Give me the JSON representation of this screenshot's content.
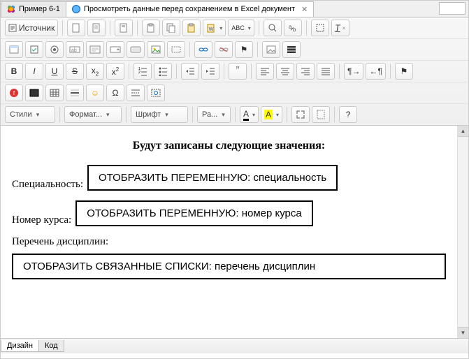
{
  "topTabs": {
    "tab1": "Пример 6-1",
    "tab2": "Просмотреть данные перед сохранением в Excel документ"
  },
  "toolbar": {
    "source": "Источник",
    "styles": "Стили",
    "format": "Формат...",
    "font": "Шрифт",
    "size": "Ра...",
    "textColor": "A",
    "bgColor": "A",
    "bold": "B",
    "italic": "I",
    "underline": "U",
    "strike": "S",
    "omega": "Ω",
    "smile": "☺",
    "question": "?",
    "abc": "ABC",
    "flag": "⚑"
  },
  "doc": {
    "heading": "Будут записаны следующие значения:",
    "label1": "Специальность:",
    "box1": "ОТОБРАЗИТЬ ПЕРЕМЕННУЮ: специальность",
    "label2": "Номер курса:",
    "box2": "ОТОБРАЗИТЬ ПЕРЕМЕННУЮ: номер курса",
    "label3": "Перечень дисциплин:",
    "box3": "ОТОБРАЗИТЬ СВЯЗАННЫЕ СПИСКИ: перечень дисциплин"
  },
  "bottomTabs": {
    "design": "Дизайн",
    "code": "Код"
  }
}
